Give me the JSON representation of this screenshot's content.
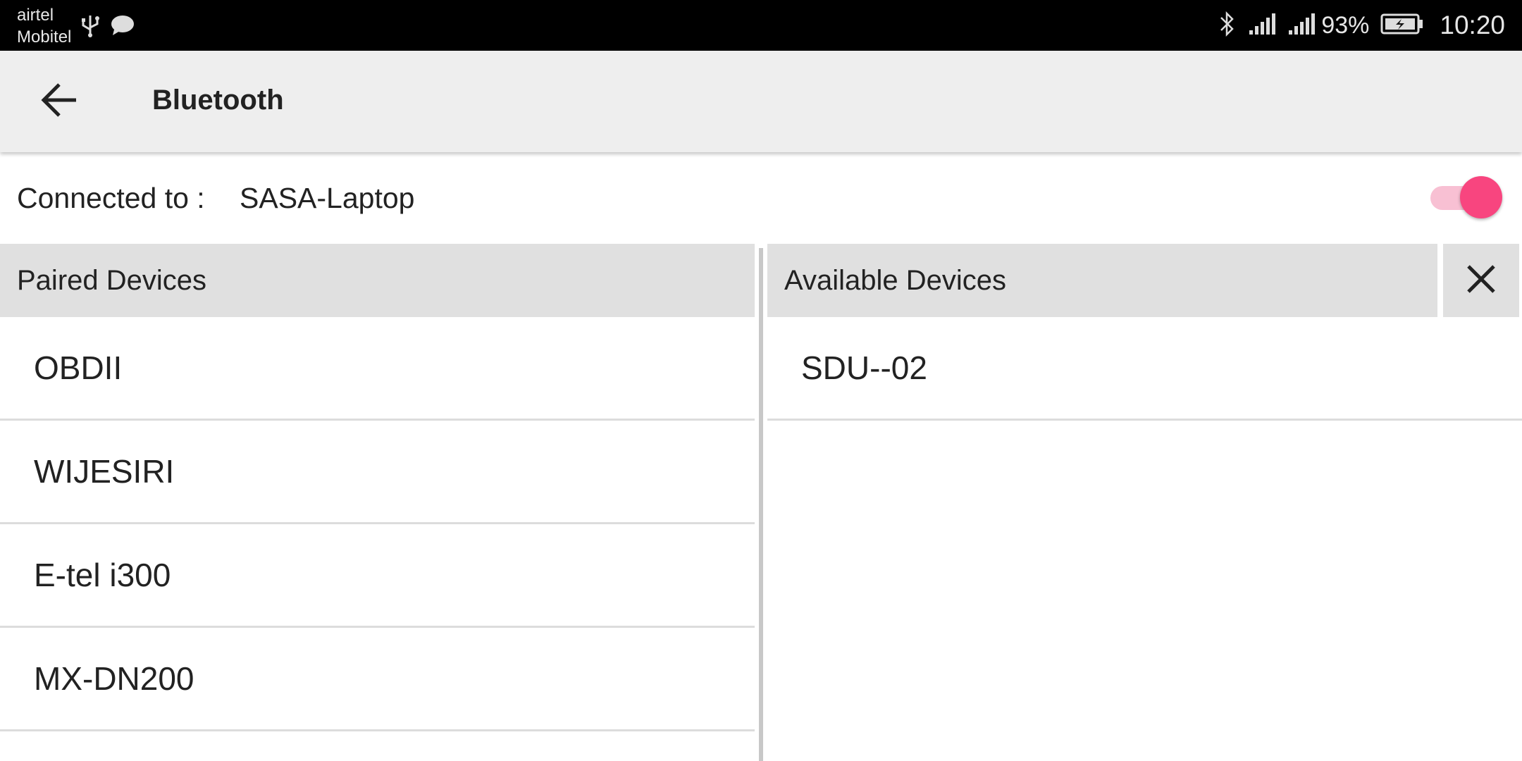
{
  "statusbar": {
    "carrier_1": "airtel",
    "carrier_2": "Mobitel",
    "battery_percent": "93%",
    "time": "10:20",
    "icons": [
      "usb-icon",
      "message-icon",
      "bluetooth-status-icon",
      "signal-icon",
      "signal-icon",
      "battery-charging-icon"
    ]
  },
  "appbar": {
    "title": "Bluetooth",
    "back_icon": "arrow-back-icon"
  },
  "connection": {
    "label": "Connected to :",
    "device": "SASA-Laptop",
    "bluetooth_enabled": true,
    "accent_color": "#f8457f"
  },
  "paired": {
    "header": "Paired Devices",
    "devices": [
      "OBDII",
      "WIJESIRI",
      "E-tel i300",
      "MX-DN200"
    ]
  },
  "available": {
    "header": "Available Devices",
    "close_icon": "close-icon",
    "devices": [
      "SDU--02"
    ]
  }
}
